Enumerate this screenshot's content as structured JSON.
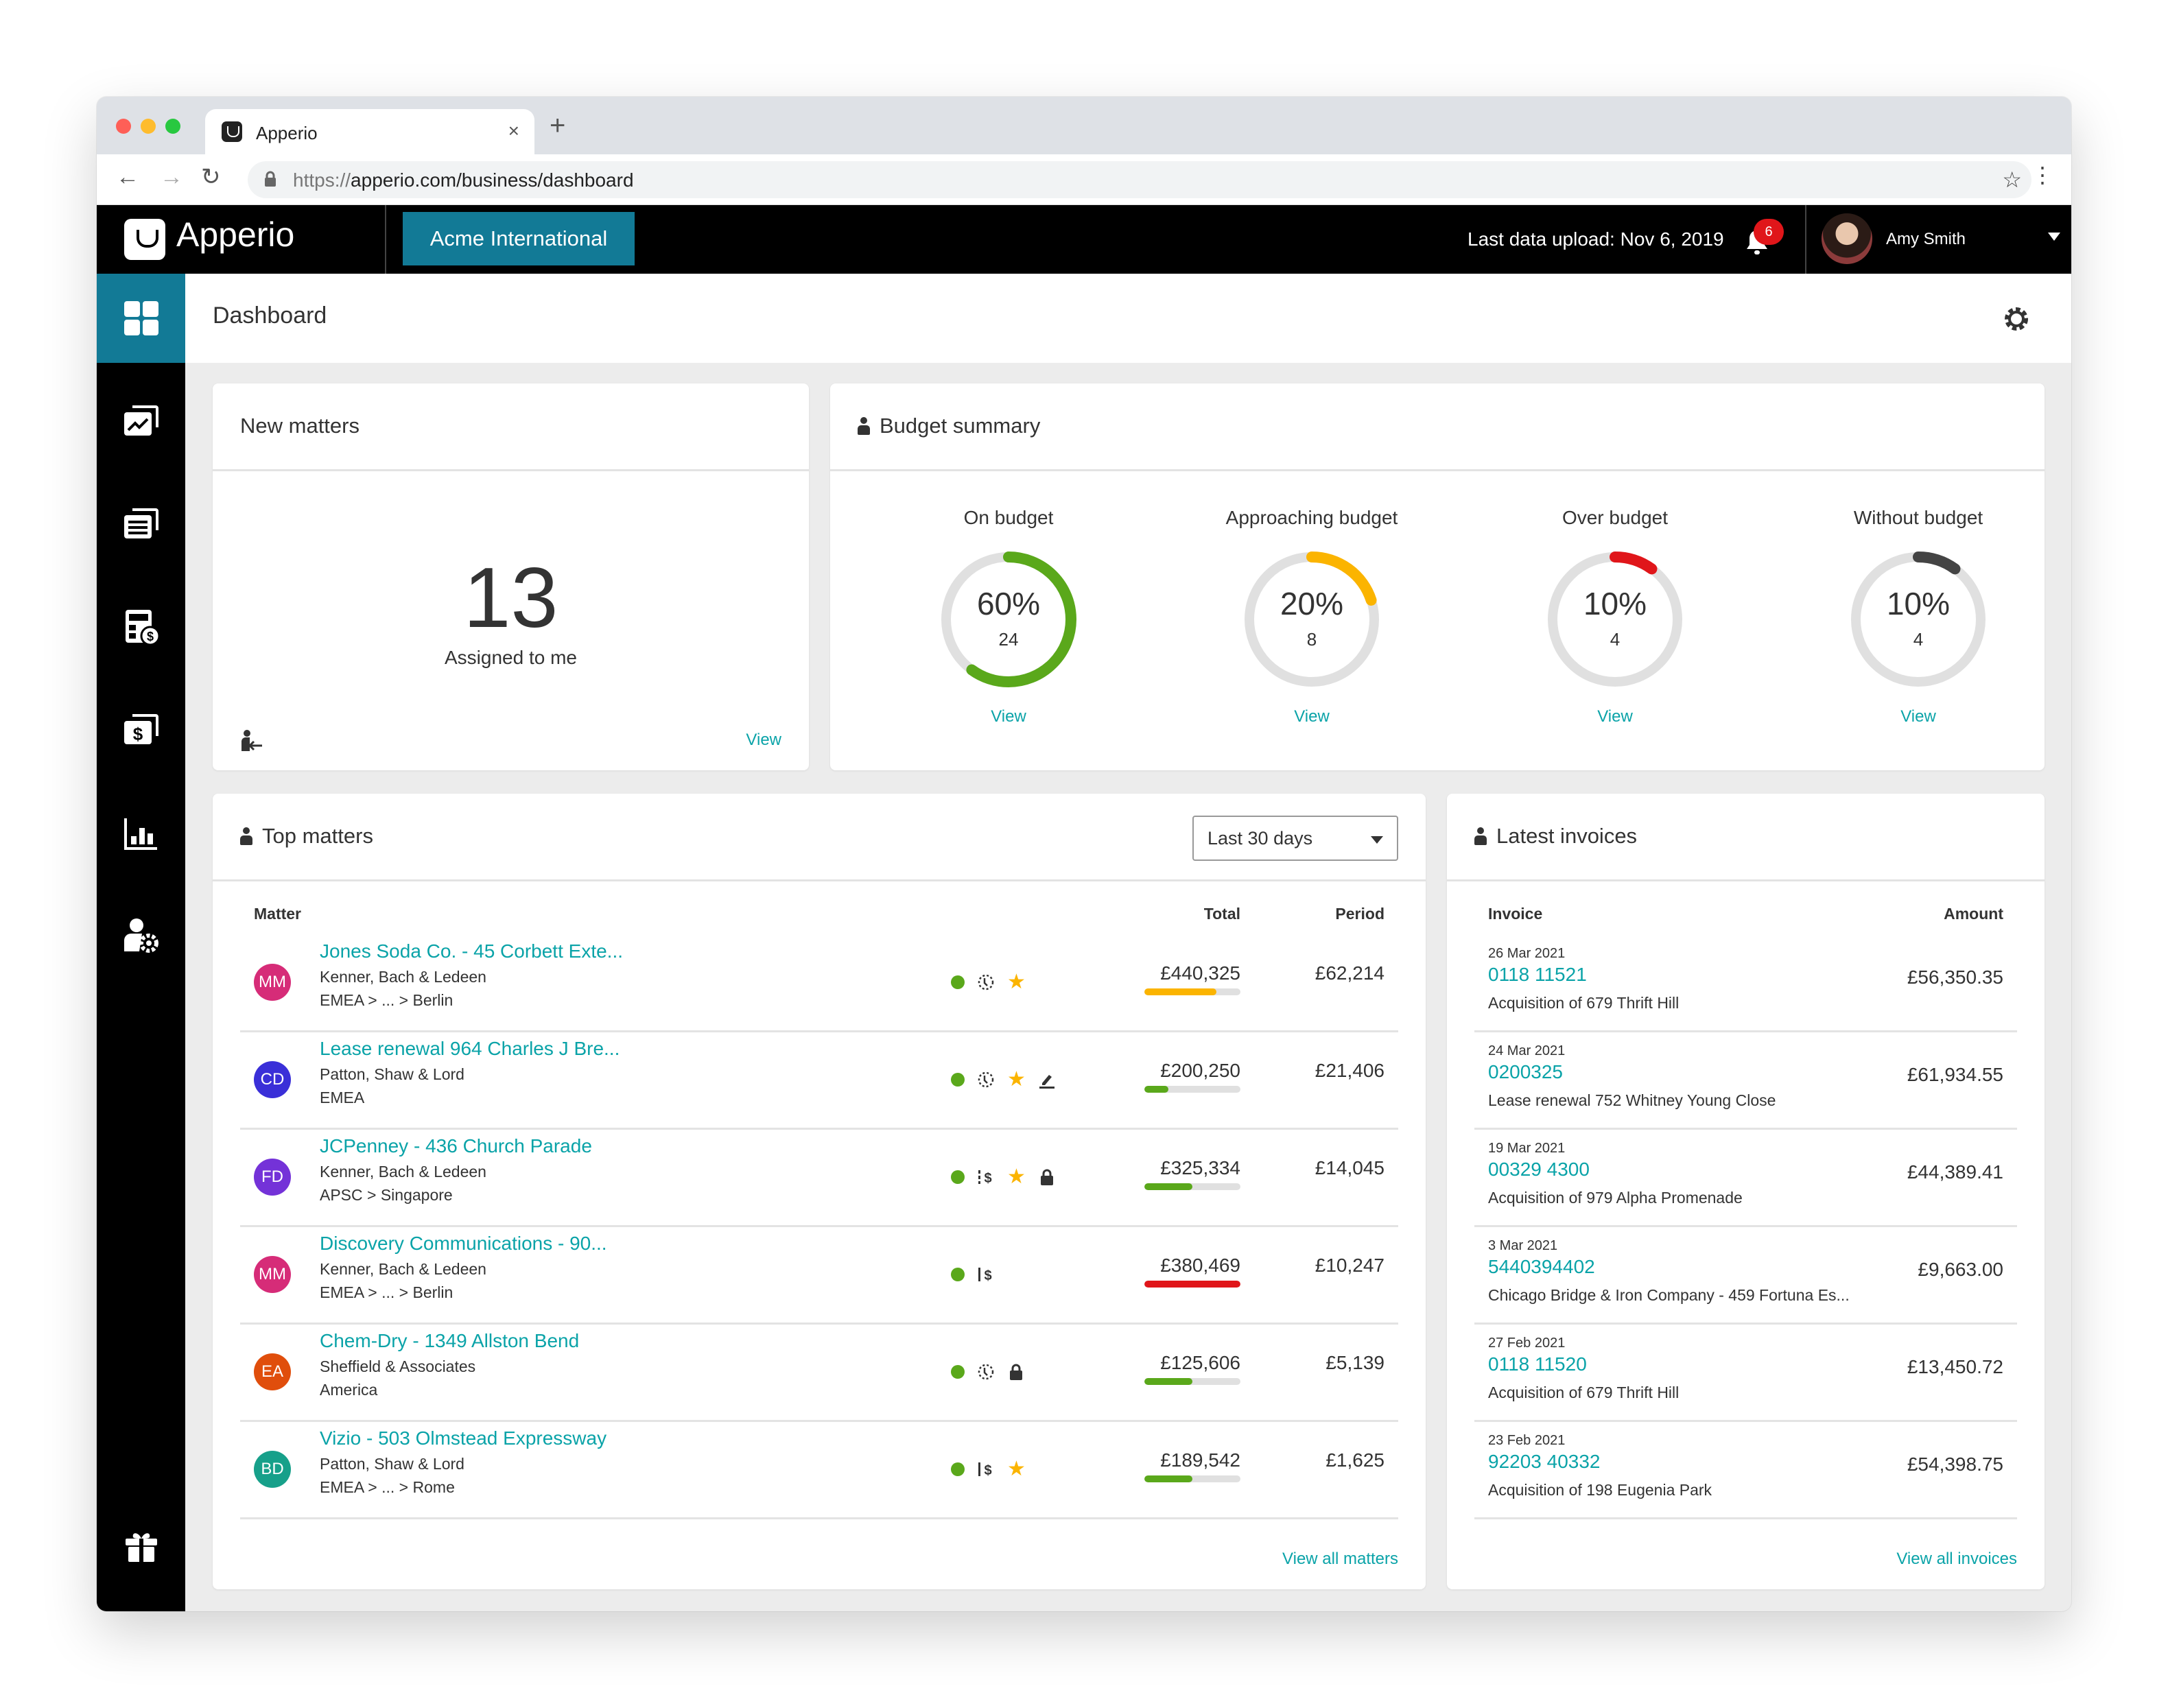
{
  "browser": {
    "tab_title": "Apperio",
    "url_protocol": "https://",
    "url_rest": "apperio.com/business/dashboard"
  },
  "header": {
    "logo": "Apperio",
    "organization": "Acme International",
    "last_upload": "Last data upload: Nov 6, 2019",
    "notification_count": "6",
    "user_name": "Amy Smith"
  },
  "sidebar": {
    "items": [
      {
        "icon": "dashboard-icon",
        "active": true
      },
      {
        "icon": "matters-trend-icon",
        "active": false
      },
      {
        "icon": "documents-icon",
        "active": false
      },
      {
        "icon": "budget-calculator-icon",
        "active": false
      },
      {
        "icon": "invoices-dollar-icon",
        "active": false
      },
      {
        "icon": "reports-chart-icon",
        "active": false
      },
      {
        "icon": "user-settings-icon",
        "active": false
      }
    ],
    "bottom_icon": "gift-icon"
  },
  "page": {
    "title": "Dashboard"
  },
  "new_matters": {
    "title": "New matters",
    "count": "13",
    "subtitle": "Assigned to me",
    "view_label": "View"
  },
  "budget_summary": {
    "title": "Budget summary",
    "items": [
      {
        "label": "On budget",
        "percent": "60%",
        "fraction": 0.6,
        "count": "24",
        "color": "#5aa81b",
        "view": "View"
      },
      {
        "label": "Approaching budget",
        "percent": "20%",
        "fraction": 0.2,
        "count": "8",
        "color": "#fbb400",
        "view": "View"
      },
      {
        "label": "Over budget",
        "percent": "10%",
        "fraction": 0.1,
        "count": "4",
        "color": "#e0161a",
        "view": "View"
      },
      {
        "label": "Without budget",
        "percent": "10%",
        "fraction": 0.1,
        "count": "4",
        "color": "#444444",
        "view": "View"
      }
    ]
  },
  "top_matters": {
    "title": "Top matters",
    "period_select": "Last 30 days",
    "columns": {
      "matter": "Matter",
      "total": "Total",
      "period": "Period"
    },
    "rows": [
      {
        "initials": "MM",
        "avatar_color": "#d62c78",
        "title": "Jones Soda Co. - 45 Corbett Exte...",
        "firm": "Kenner, Bach & Ledeen",
        "location": "EMEA > ... > Berlin",
        "icons": [
          "status-dot",
          "time-icon",
          "star"
        ],
        "total": "£440,325",
        "progress": 0.75,
        "progress_color": "#fbb400",
        "period": "£62,214"
      },
      {
        "initials": "CD",
        "avatar_color": "#3a2fd8",
        "title": "Lease renewal 964 Charles J Bre...",
        "firm": "Patton, Shaw & Lord",
        "location": "EMEA",
        "icons": [
          "status-dot",
          "time-icon",
          "star",
          "edit-icon"
        ],
        "total": "£200,250",
        "progress": 0.25,
        "progress_color": "#5aa81b",
        "period": "£21,406"
      },
      {
        "initials": "FD",
        "avatar_color": "#7432d8",
        "title": "JCPenney - 436 Church Parade",
        "firm": "Kenner, Bach & Ledeen",
        "location": "APSC > Singapore",
        "icons": [
          "status-dot",
          "fee-dashed-icon",
          "star",
          "lock-icon"
        ],
        "total": "£325,334",
        "progress": 0.5,
        "progress_color": "#5aa81b",
        "period": "£14,045"
      },
      {
        "initials": "MM",
        "avatar_color": "#d62c78",
        "title": "Discovery Communications - 90...",
        "firm": "Kenner, Bach & Ledeen",
        "location": "EMEA > ... > Berlin",
        "icons": [
          "status-dot",
          "fee-icon"
        ],
        "total": "£380,469",
        "progress": 1.0,
        "progress_color": "#e0161a",
        "period": "£10,247"
      },
      {
        "initials": "EA",
        "avatar_color": "#e04e0c",
        "title": "Chem-Dry - 1349 Allston Bend",
        "firm": "Sheffield & Associates",
        "location": "America",
        "icons": [
          "status-dot",
          "time-icon",
          "lock-icon"
        ],
        "total": "£125,606",
        "progress": 0.5,
        "progress_color": "#5aa81b",
        "period": "£5,139"
      },
      {
        "initials": "BD",
        "avatar_color": "#17a08a",
        "title": "Vizio - 503 Olmstead Expressway",
        "firm": "Patton, Shaw & Lord",
        "location": "EMEA > ... > Rome",
        "icons": [
          "status-dot",
          "fee-icon",
          "star"
        ],
        "total": "£189,542",
        "progress": 0.5,
        "progress_color": "#5aa81b",
        "period": "£1,625"
      }
    ],
    "view_all": "View all matters"
  },
  "latest_invoices": {
    "title": "Latest invoices",
    "columns": {
      "invoice": "Invoice",
      "amount": "Amount"
    },
    "rows": [
      {
        "date": "26 Mar 2021",
        "number": "0118 11521",
        "description": "Acquisition of 679 Thrift Hill",
        "amount": "£56,350.35"
      },
      {
        "date": "24 Mar 2021",
        "number": "0200325",
        "description": "Lease renewal 752 Whitney Young Close",
        "amount": "£61,934.55"
      },
      {
        "date": "19 Mar 2021",
        "number": "00329 4300",
        "description": "Acquisition of 979 Alpha Promenade",
        "amount": "£44,389.41"
      },
      {
        "date": "3 Mar 2021",
        "number": "5440394402",
        "description": "Chicago Bridge & Iron Company - 459 Fortuna Es...",
        "amount": "£9,663.00"
      },
      {
        "date": "27 Feb 2021",
        "number": "0118 11520",
        "description": "Acquisition of 679 Thrift Hill",
        "amount": "£13,450.72"
      },
      {
        "date": "23 Feb 2021",
        "number": "92203 40332",
        "description": "Acquisition of 198 Eugenia Park",
        "amount": "£54,398.75"
      }
    ],
    "view_all": "View all invoices"
  }
}
